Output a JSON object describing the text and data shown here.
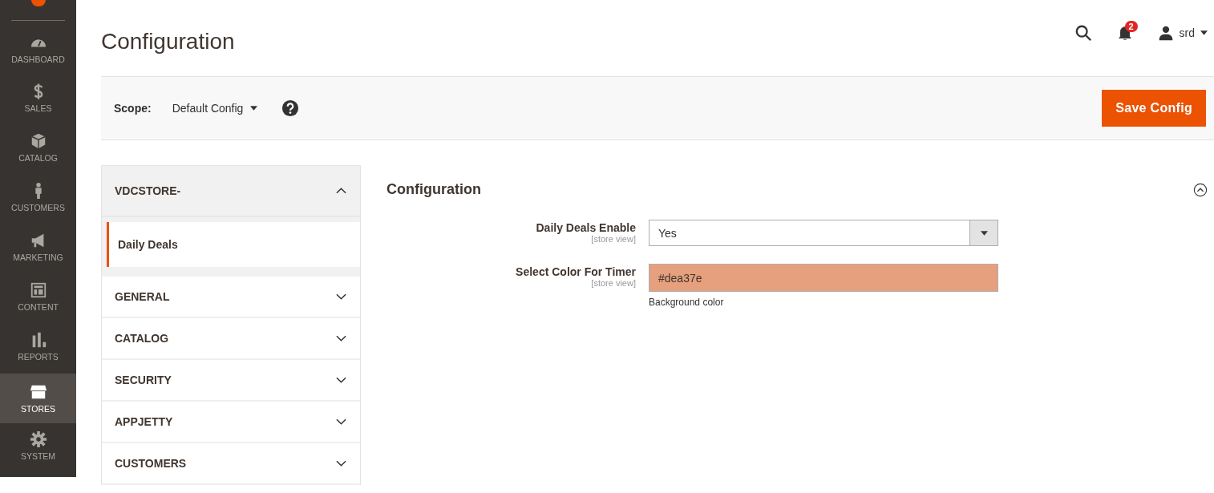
{
  "nav": [
    {
      "label": "DASHBOARD",
      "selected": false
    },
    {
      "label": "SALES",
      "selected": false
    },
    {
      "label": "CATALOG",
      "selected": false
    },
    {
      "label": "CUSTOMERS",
      "selected": false
    },
    {
      "label": "MARKETING",
      "selected": false
    },
    {
      "label": "CONTENT",
      "selected": false
    },
    {
      "label": "REPORTS",
      "selected": false
    },
    {
      "label": "STORES",
      "selected": true
    },
    {
      "label": "SYSTEM",
      "selected": false
    }
  ],
  "page_title": "Configuration",
  "header": {
    "notification_count": "2",
    "user": "srd"
  },
  "toolbar": {
    "scope_label": "Scope:",
    "scope_value": "Default Config",
    "save_button": "Save Config"
  },
  "tabs": [
    {
      "title": "VDCSTORE-",
      "expanded": true,
      "children": [
        {
          "label": "Daily Deals",
          "selected": true
        }
      ]
    },
    {
      "title": "GENERAL",
      "expanded": false
    },
    {
      "title": "CATALOG",
      "expanded": false
    },
    {
      "title": "SECURITY",
      "expanded": false
    },
    {
      "title": "APPJETTY",
      "expanded": false
    },
    {
      "title": "CUSTOMERS",
      "expanded": false
    }
  ],
  "section": {
    "title": "Configuration",
    "expanded": true,
    "fields": [
      {
        "kind": "select",
        "label": "Daily Deals Enable",
        "scope": "[store view]",
        "value": "Yes"
      },
      {
        "kind": "color",
        "label": "Select Color For Timer",
        "scope": "[store view]",
        "value": "#dea37e",
        "color": "#e6a07e",
        "note": "Background color"
      }
    ]
  }
}
